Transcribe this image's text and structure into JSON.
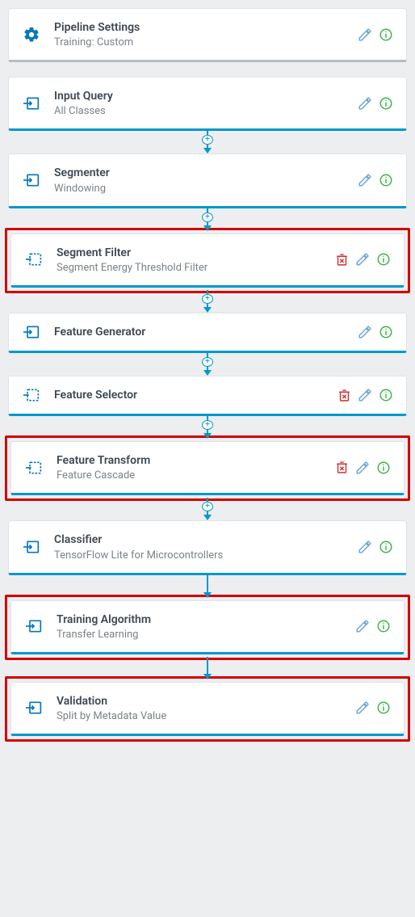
{
  "steps": [
    {
      "title": "Pipeline Settings",
      "subtitle": "Training:  Custom",
      "icon": "gear",
      "accent": "gray",
      "deletable": false,
      "highlighted": false,
      "connector": "gap"
    },
    {
      "title": "Input Query",
      "subtitle": "All Classes",
      "icon": "input",
      "accent": "teal",
      "deletable": false,
      "highlighted": false,
      "connector": "plus"
    },
    {
      "title": "Segmenter",
      "subtitle": "Windowing",
      "icon": "input",
      "accent": "teal",
      "deletable": false,
      "highlighted": false,
      "connector": "plus"
    },
    {
      "title": "Segment Filter",
      "subtitle": "Segment Energy Threshold Filter",
      "icon": "filter",
      "accent": "teal",
      "deletable": true,
      "highlighted": true,
      "connector": "plus"
    },
    {
      "title": "Feature Generator",
      "subtitle": "",
      "icon": "input",
      "accent": "teal",
      "deletable": false,
      "highlighted": false,
      "connector": "plus"
    },
    {
      "title": "Feature Selector",
      "subtitle": "",
      "icon": "filter",
      "accent": "teal",
      "deletable": true,
      "highlighted": false,
      "connector": "plus"
    },
    {
      "title": "Feature Transform",
      "subtitle": "Feature Cascade",
      "icon": "filter",
      "accent": "teal",
      "deletable": true,
      "highlighted": true,
      "connector": "plus"
    },
    {
      "title": "Classifier",
      "subtitle": "TensorFlow Lite for Microcontrollers",
      "icon": "input",
      "accent": "teal",
      "deletable": false,
      "highlighted": false,
      "connector": "arrow"
    },
    {
      "title": "Training Algorithm",
      "subtitle": "Transfer Learning",
      "icon": "input",
      "accent": "teal",
      "deletable": false,
      "highlighted": true,
      "connector": "arrow"
    },
    {
      "title": "Validation",
      "subtitle": "Split by Metadata Value",
      "icon": "input",
      "accent": "teal",
      "deletable": false,
      "highlighted": true,
      "connector": "none"
    }
  ]
}
